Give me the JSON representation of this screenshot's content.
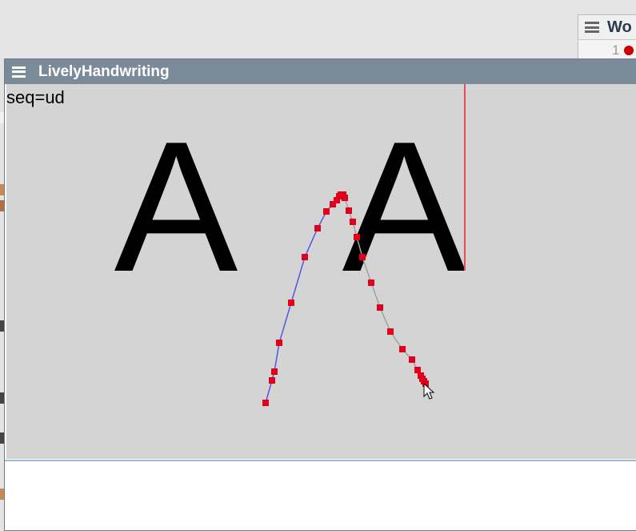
{
  "background_window": {
    "title": "Wo",
    "row_number": "1"
  },
  "window": {
    "title": "LivelyHandwriting"
  },
  "canvas": {
    "seq_label": "seq=ud",
    "glyphs": [
      "A",
      "A"
    ],
    "colors": {
      "background": "#d4d4d4",
      "stroke_up": "#5555dd",
      "stroke_down": "#a0a0a0",
      "points": "#e0001b",
      "cursor_line": "#e05050"
    }
  },
  "icons": [
    "menu-icon",
    "mouse-cursor-icon"
  ]
}
